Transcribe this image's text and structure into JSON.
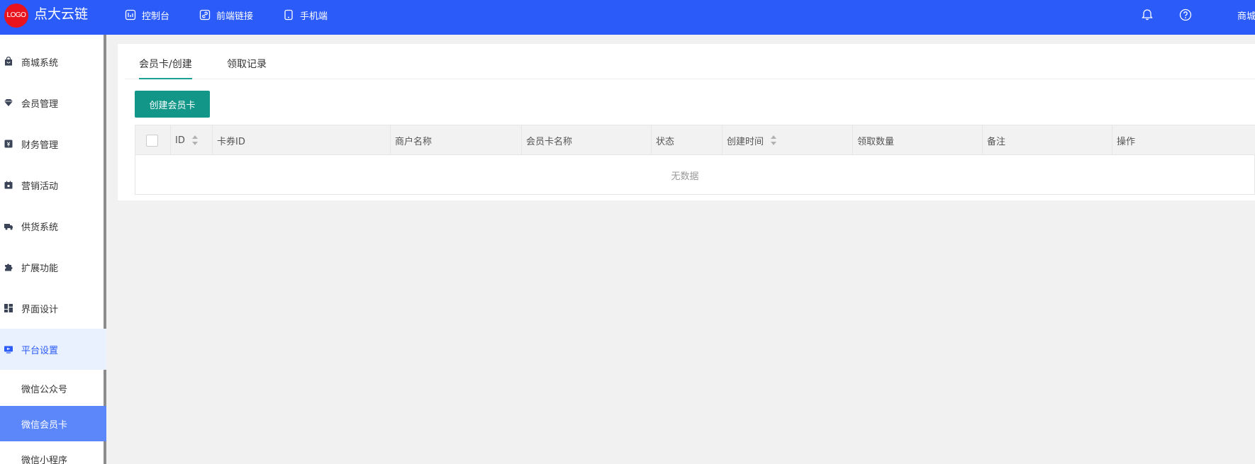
{
  "header": {
    "logo_text": "LOGO",
    "brand": "点大云链",
    "nav": [
      {
        "label": "控制台",
        "icon": "dashboard-icon"
      },
      {
        "label": "前端链接",
        "icon": "link-icon"
      },
      {
        "label": "手机端",
        "icon": "mobile-icon"
      }
    ],
    "icons": [
      "bell-icon",
      "help-icon"
    ],
    "user_text": "商城"
  },
  "sidebar": {
    "items": [
      {
        "label": "商城系统",
        "icon": "shopping-bag-icon"
      },
      {
        "label": "会员管理",
        "icon": "diamond-icon"
      },
      {
        "label": "财务管理",
        "icon": "wallet-icon"
      },
      {
        "label": "营销活动",
        "icon": "calendar-icon"
      },
      {
        "label": "供货系统",
        "icon": "truck-icon"
      },
      {
        "label": "扩展功能",
        "icon": "puzzle-icon"
      },
      {
        "label": "界面设计",
        "icon": "layout-icon"
      },
      {
        "label": "平台设置",
        "icon": "monitor-icon",
        "active": true
      }
    ],
    "sub_items": [
      {
        "label": "微信公众号"
      },
      {
        "label": "微信会员卡",
        "selected": true
      },
      {
        "label": "微信小程序"
      }
    ]
  },
  "main": {
    "tabs": [
      {
        "label": "会员卡/创建",
        "active": true
      },
      {
        "label": "领取记录"
      }
    ],
    "create_button": "创建会员卡",
    "table": {
      "columns": [
        "ID",
        "卡券ID",
        "商户名称",
        "会员卡名称",
        "状态",
        "创建时间",
        "领取数量",
        "备注",
        "操作"
      ],
      "empty_text": "无数据"
    }
  },
  "colors": {
    "header_bg": "#2b5bf8",
    "logo_bg": "#e8131d",
    "primary_button": "#119688",
    "tab_active_underline": "#1aa094",
    "sidebar_active_bg": "#e9f0fe",
    "sidebar_selected_bg": "#5b87fb"
  }
}
